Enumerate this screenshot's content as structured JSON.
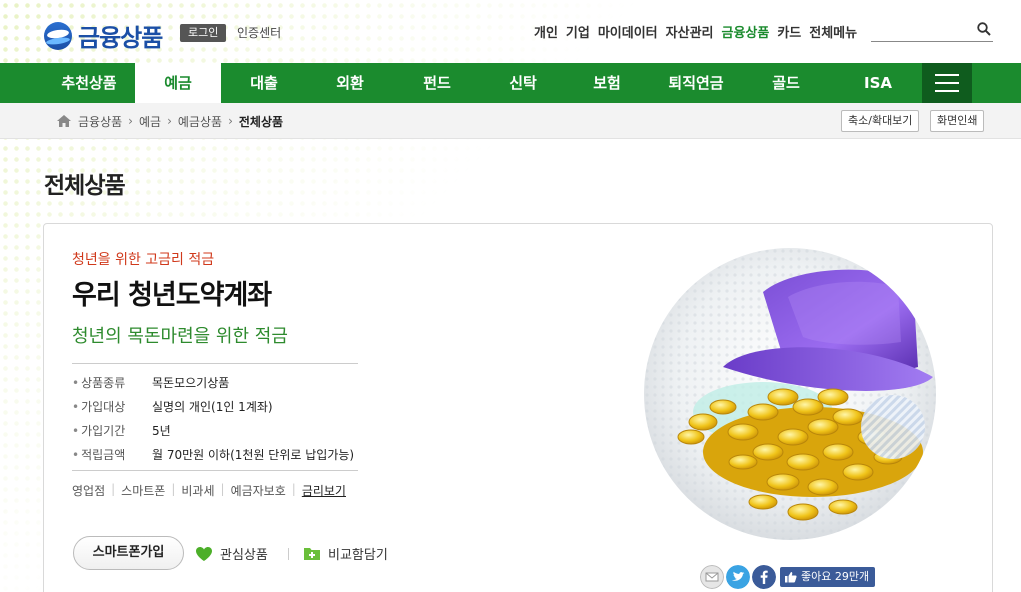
{
  "brand": {
    "logo_text": "금융상품",
    "login": "로그인",
    "cert_center": "인증센터"
  },
  "top_menu": [
    {
      "label": "개인",
      "active": false
    },
    {
      "label": "기업",
      "active": false
    },
    {
      "label": "마이데이터",
      "active": false
    },
    {
      "label": "자산관리",
      "active": false
    },
    {
      "label": "금융상품",
      "active": true
    },
    {
      "label": "카드",
      "active": false
    },
    {
      "label": "전체메뉴",
      "active": false
    }
  ],
  "search": {
    "placeholder": ""
  },
  "nav": {
    "items": [
      "추천상품",
      "예금",
      "대출",
      "외환",
      "펀드",
      "신탁",
      "보험",
      "퇴직연금",
      "골드",
      "ISA"
    ],
    "active_index": 1
  },
  "breadcrumb": {
    "items": [
      "금융상품",
      "예금",
      "예금상품"
    ],
    "current": "전체상품"
  },
  "tools": {
    "zoom": "축소/확대보기",
    "print": "화면인쇄"
  },
  "page_title": "전체상품",
  "product": {
    "kicker": "청년을 위한 고금리 적금",
    "name": "우리 청년도약계좌",
    "subtitle": "청년의 목돈마련을 위한 적금",
    "info": [
      {
        "label": "상품종류",
        "value": "목돈모으기상품"
      },
      {
        "label": "가입대상",
        "value": "실명의 개인(1인 1계좌)"
      },
      {
        "label": "가입기간",
        "value": "5년"
      },
      {
        "label": "적립금액",
        "value": "월 70만원 이하(1천원 단위로 납입가능)"
      }
    ],
    "links": [
      "영업점",
      "스마트폰",
      "비과세",
      "예금자보호",
      "금리보기"
    ],
    "actions": {
      "smart_join": "스마트폰가입",
      "favorite": "관심상품",
      "compare": "비교함담기"
    }
  },
  "share": {
    "like_label": "좋아요 29만개"
  },
  "colors": {
    "brand_green": "#1b8b2e",
    "brand_blue": "#1b4fa6",
    "kicker_red": "#d0391b",
    "subtitle_green": "#2e8b2e"
  }
}
